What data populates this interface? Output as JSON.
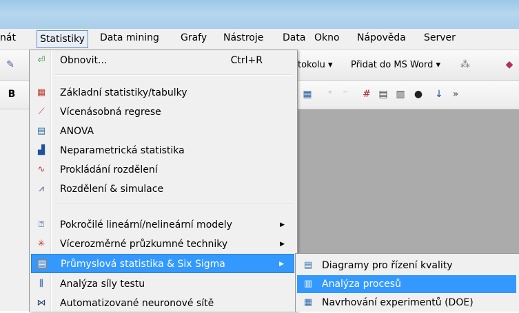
{
  "menubar": {
    "items": [
      {
        "label": "nát"
      },
      {
        "label": "Statistiky",
        "open": true
      },
      {
        "label": "Data mining"
      },
      {
        "label": "Grafy"
      },
      {
        "label": "Nástroje"
      },
      {
        "label": "Data"
      },
      {
        "label": "Okno"
      },
      {
        "label": "Nápověda"
      },
      {
        "label": "Server"
      }
    ]
  },
  "toolbar": {
    "protocol_label": "tokolu ▾",
    "word_label": "Přidat do MS Word ▾"
  },
  "menu": {
    "items": [
      {
        "label": "Obnovit...",
        "shortcut": "Ctrl+R",
        "icon": "refresh-icon",
        "glyph": "⏎"
      },
      {
        "label": "Základní statistiky/tabulky",
        "icon": "basic-stats-icon",
        "glyph": "▦"
      },
      {
        "label": "Vícenásobná regrese",
        "icon": "regression-icon",
        "glyph": "⟋"
      },
      {
        "label": "ANOVA",
        "icon": "anova-icon",
        "glyph": "▤"
      },
      {
        "label": "Neparametrická statistika",
        "icon": "nonparametric-icon",
        "glyph": "▟"
      },
      {
        "label": "Prokládání rozdělení",
        "icon": "distribution-fit-icon",
        "glyph": "∿"
      },
      {
        "label": "Rozdělení & simulace",
        "icon": "simulation-icon",
        "glyph": "⩘"
      },
      {
        "label": "Pokročilé lineární/nelineární modely",
        "icon": "advanced-models-icon",
        "glyph": "⍰",
        "submenu": true
      },
      {
        "label": "Vícerozměrné průzkumné techniky",
        "icon": "multivariate-icon",
        "glyph": "✳",
        "submenu": true
      },
      {
        "label": "Průmyslová statistika & Six Sigma",
        "icon": "six-sigma-icon",
        "glyph": "▤",
        "submenu": true,
        "highlighted": true
      },
      {
        "label": "Analýza síly testu",
        "icon": "power-analysis-icon",
        "glyph": "⫼"
      },
      {
        "label": "Automatizované neuronové sítě",
        "icon": "neural-network-icon",
        "glyph": "⋈"
      }
    ]
  },
  "submenu": {
    "items": [
      {
        "label": "Diagramy pro řízení kvality",
        "icon": "quality-control-icon",
        "glyph": "▤"
      },
      {
        "label": "Analýza procesů",
        "icon": "process-analysis-icon",
        "glyph": "▥",
        "highlighted": true
      },
      {
        "label": "Navrhování experimentů (DOE)",
        "icon": "doe-icon",
        "glyph": "▦"
      }
    ]
  }
}
